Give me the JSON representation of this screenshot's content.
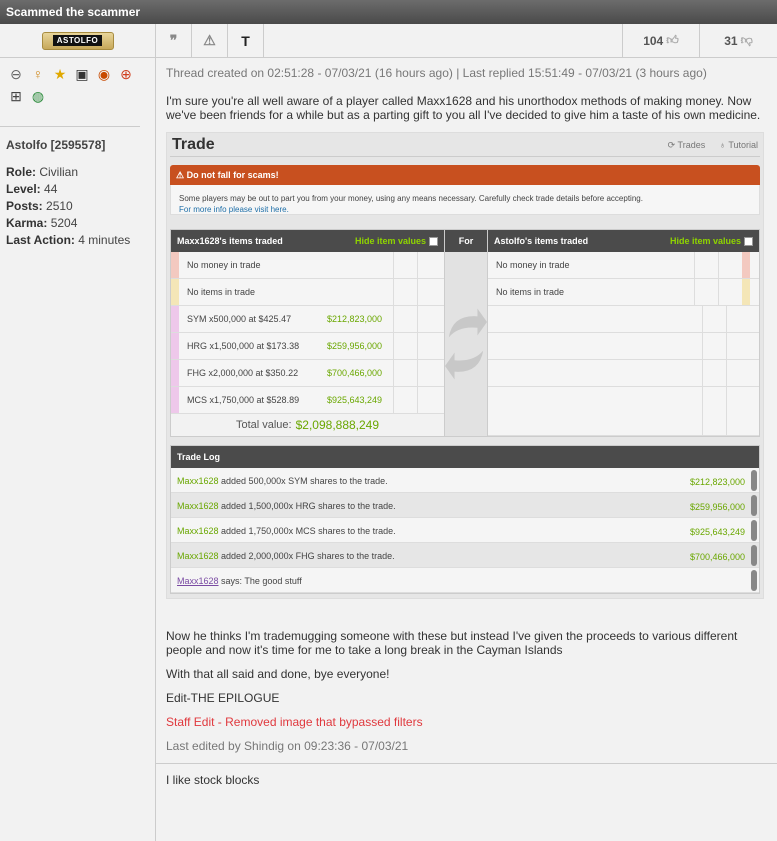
{
  "title": "Scammed the scammer",
  "author": {
    "badge": "ASTOLFO",
    "name": "Astolfo [2595578]",
    "role_label": "Role:",
    "role": "Civilian",
    "level_label": "Level:",
    "level": "44",
    "posts_label": "Posts:",
    "posts": "2510",
    "karma_label": "Karma:",
    "karma": "5204",
    "action_label": "Last Action:",
    "action": "4 minutes"
  },
  "toolbar": {
    "upvotes": "104",
    "downvotes": "31"
  },
  "post": {
    "meta": "Thread created on 02:51:28 - 07/03/21 (16 hours ago) | Last replied 15:51:49 - 07/03/21 (3 hours ago)",
    "intro": "I'm sure you're all well aware of a player called Maxx1628 and his unorthodox methods of making money. Now we've been friends for a while but as a parting gift to you all I've decided to give him a taste of his own medicine.",
    "after1": "Now he thinks I'm trademugging someone with these but instead I've given the proceeds to various different people and now it's time for me to take a long break in the Cayman Islands",
    "after2": "With that all said and done, bye everyone!",
    "edit": "Edit-THE EPILOGUE",
    "staff": "Staff Edit - Removed image that bypassed filters",
    "edited": "Last edited by Shindig on 09:23:36 - 07/03/21",
    "reply": "I like stock blocks"
  },
  "trade": {
    "title": "Trade",
    "trades_link": "Trades",
    "tutorial_link": "Tutorial",
    "warn_title": "Do not fall for scams!",
    "warn_body": "Some players may be out to part you from your money, using any means necessary. Carefully check trade details before accepting.",
    "warn_link": "For more info please visit here.",
    "left_head": "Maxx1628's items traded",
    "right_head": "Astolfo's items traded",
    "hide_values": "Hide item values",
    "for_label": "For",
    "left_rows": [
      {
        "text": "No money in trade",
        "value": ""
      },
      {
        "text": "No items in trade",
        "value": ""
      },
      {
        "text": "SYM x500,000 at $425.47",
        "value": "$212,823,000"
      },
      {
        "text": "HRG x1,500,000 at $173.38",
        "value": "$259,956,000"
      },
      {
        "text": "FHG x2,000,000 at $350.22",
        "value": "$700,466,000"
      },
      {
        "text": "MCS x1,750,000 at $528.89",
        "value": "$925,643,249"
      }
    ],
    "right_rows": [
      {
        "text": "No money in trade"
      },
      {
        "text": "No items in trade"
      }
    ],
    "total_label": "Total value:",
    "total_value": "$2,098,888,249",
    "log_title": "Trade Log",
    "log": [
      {
        "who": "Maxx1628",
        "text": " added 500,000x SYM shares to the trade.",
        "value": "$212,823,000"
      },
      {
        "who": "Maxx1628",
        "text": " added 1,500,000x HRG shares to the trade.",
        "value": "$259,956,000"
      },
      {
        "who": "Maxx1628",
        "text": " added 1,750,000x MCS shares to the trade.",
        "value": "$925,643,249"
      },
      {
        "who": "Maxx1628",
        "text": " added 2,000,000x FHG shares to the trade.",
        "value": "$700,466,000"
      }
    ],
    "says_who": "Maxx1628",
    "says_text": " says: The good stuff"
  },
  "colors": {
    "money_green": "#6aa700",
    "warn_orange": "#c8501f",
    "staff_red": "#e0393e"
  }
}
